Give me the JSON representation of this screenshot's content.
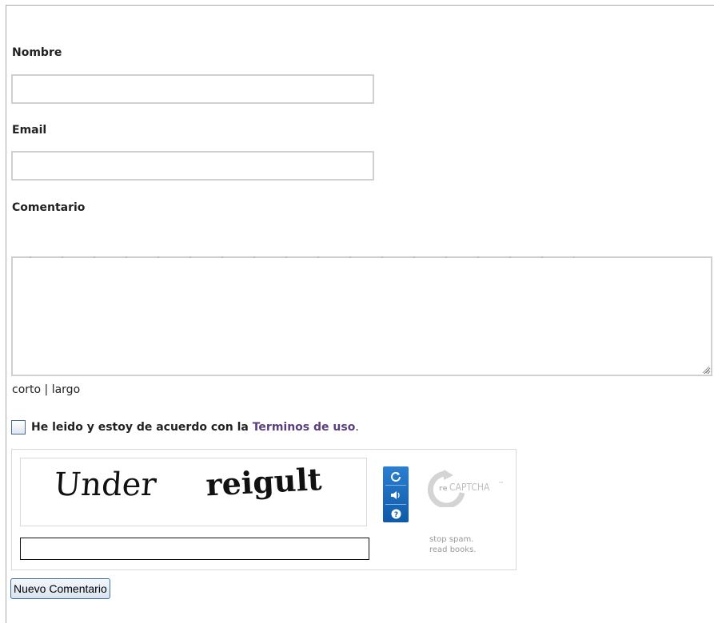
{
  "form": {
    "name_label": "Nombre",
    "name_value": "",
    "email_label": "Email",
    "email_value": "",
    "comment_label": "Comentario",
    "comment_value": "",
    "size_short": "corto",
    "size_separator": " | ",
    "size_long": "largo",
    "terms_text": "He leido y estoy de acuerdo con la ",
    "terms_link": "Terminos de uso",
    "terms_period": ".",
    "terms_checked": false,
    "submit_label": "Nuevo Comentario"
  },
  "captcha": {
    "word_1": "Under",
    "word_2": "reigult",
    "answer_value": "",
    "logo_prefix": "re",
    "logo_text": "CAPTCHA",
    "logo_tm": "™",
    "tagline_line1": "stop spam.",
    "tagline_line2": "read books.",
    "controls": [
      "refresh-icon",
      "audio-icon",
      "help-icon"
    ],
    "accent_color": "#1a6cc0"
  }
}
